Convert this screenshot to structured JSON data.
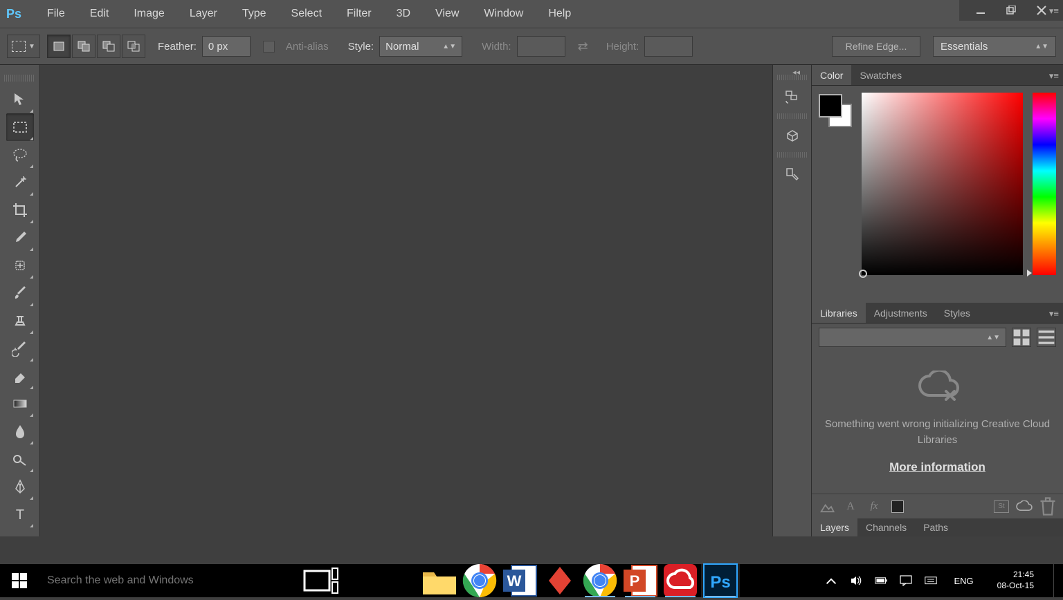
{
  "menubar": {
    "items": [
      "File",
      "Edit",
      "Image",
      "Layer",
      "Type",
      "Select",
      "Filter",
      "3D",
      "View",
      "Window",
      "Help"
    ]
  },
  "options": {
    "feather_label": "Feather:",
    "feather_value": "0 px",
    "antialias_label": "Anti-alias",
    "style_label": "Style:",
    "style_value": "Normal",
    "width_label": "Width:",
    "height_label": "Height:",
    "refine_label": "Refine Edge...",
    "workspace_value": "Essentials"
  },
  "panels": {
    "color_tab": "Color",
    "swatches_tab": "Swatches",
    "libraries_tab": "Libraries",
    "adjustments_tab": "Adjustments",
    "styles_tab": "Styles",
    "layers_tab": "Layers",
    "channels_tab": "Channels",
    "paths_tab": "Paths",
    "lib_error": "Something went wrong initializing Creative Cloud Libraries",
    "lib_link": "More information"
  },
  "taskbar": {
    "search_placeholder": "Search the web and Windows",
    "lang": "ENG",
    "time": "21:45",
    "date": "08-Oct-15"
  },
  "colors": {
    "foreground": "#000000",
    "background": "#ffffff"
  }
}
